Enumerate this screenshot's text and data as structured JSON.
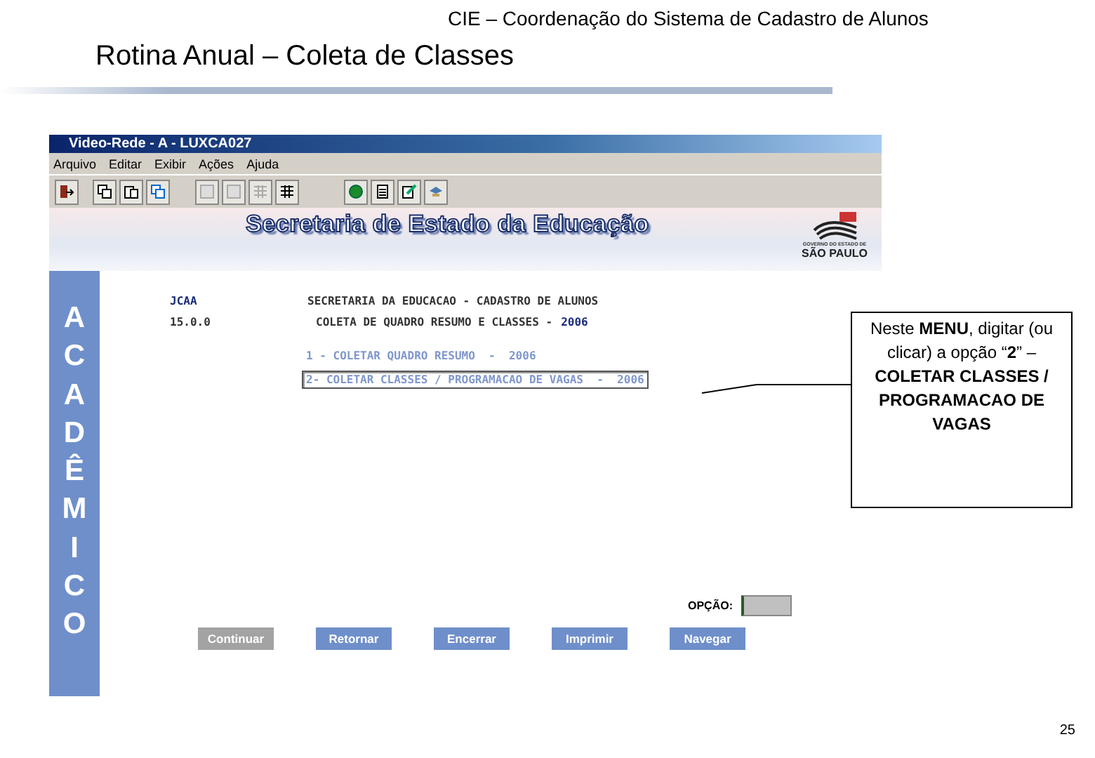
{
  "header": {
    "subtitle": "CIE – Coordenação do Sistema de Cadastro de Alunos",
    "title": "Rotina Anual – Coleta de Classes"
  },
  "app_window": {
    "title": "Video-Rede - A - LUXCA027",
    "menu": [
      "Arquivo",
      "Editar",
      "Exibir",
      "Ações",
      "Ajuda"
    ],
    "banner": {
      "title": "Secretaria de Estado da Educação",
      "logo_small": "GOVERNO DO ESTADO DE",
      "logo_name": "SÃO PAULO"
    },
    "side_label": "ACADÊMICO",
    "screen": {
      "program": "JCAA",
      "version": "15.0.0",
      "heading": "SECRETARIA DA EDUCACAO - CADASTRO DE ALUNOS",
      "subheading": "COLETA DE QUADRO RESUMO E CLASSES -",
      "year": "2006",
      "options": [
        {
          "label": "1 - COLETAR QUADRO RESUMO  -  2006",
          "selected": false
        },
        {
          "label": "2- COLETAR CLASSES / PROGRAMACAO DE VAGAS  -  2006",
          "selected": true
        }
      ],
      "option_label": "OPÇÃO:"
    },
    "buttons": [
      {
        "label": "Continuar",
        "disabled": true
      },
      {
        "label": "Retornar",
        "disabled": false
      },
      {
        "label": "Encerrar",
        "disabled": false
      },
      {
        "label": "Imprimir",
        "disabled": false
      },
      {
        "label": "Navegar",
        "disabled": false
      }
    ]
  },
  "callout": "Neste **MENU**, digitar (ou clicar) a opção “**2**” – **COLETAR CLASSES / PROGRAMACAO DE VAGAS**",
  "page_number": "25"
}
